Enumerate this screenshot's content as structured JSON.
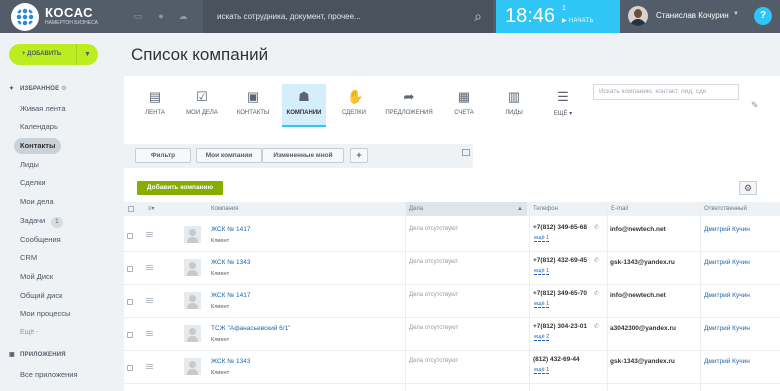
{
  "header": {
    "brand_name": "КОСАС",
    "brand_sub": "НАМЕРТОН БИЗНЕСА",
    "search_placeholder": "искать сотрудника, документ, прочее...",
    "clock": "18:46",
    "clock_flag": "1",
    "clock_action": "НАЧАТЬ",
    "user_name": "Станислав Кочурин",
    "help": "?"
  },
  "sidebar": {
    "add_button": "ДОБАВИТЬ",
    "favorites_title": "ИЗБРАННОЕ",
    "items": [
      {
        "label": "Живая лента",
        "active": false
      },
      {
        "label": "Календарь",
        "active": false
      },
      {
        "label": "Контакты",
        "active": true
      },
      {
        "label": "Лиды",
        "active": false
      },
      {
        "label": "Сделки",
        "active": false
      },
      {
        "label": "Мои дела",
        "active": false
      },
      {
        "label": "Задачи",
        "active": false,
        "count": "1"
      },
      {
        "label": "Сообщения",
        "active": false
      },
      {
        "label": "CRM",
        "active": false
      },
      {
        "label": "Мой Диск",
        "active": false
      },
      {
        "label": "Общий диск",
        "active": false
      },
      {
        "label": "Мои процессы",
        "active": false
      },
      {
        "label": "Ещё -",
        "active": false
      }
    ],
    "apps_title": "ПРИЛОЖЕНИЯ",
    "apps_items": [
      {
        "label": "Все приложения"
      }
    ]
  },
  "main": {
    "title": "Список компаний",
    "tabs": [
      {
        "label": "ЛЕНТА",
        "icon": "feed-icon",
        "glyph": "▤"
      },
      {
        "label": "МОИ ДЕЛА",
        "icon": "tasks-icon",
        "glyph": "☑"
      },
      {
        "label": "КОНТАКТЫ",
        "icon": "contacts-icon",
        "glyph": "▣"
      },
      {
        "label": "КОМПАНИИ",
        "icon": "companies-icon",
        "glyph": "☗",
        "active": true
      },
      {
        "label": "СДЕЛКИ",
        "icon": "deals-icon",
        "glyph": "✋"
      },
      {
        "label": "ПРЕДЛОЖЕНИЯ",
        "icon": "quotes-icon",
        "glyph": "➦"
      },
      {
        "label": "СЧЕТА",
        "icon": "invoices-icon",
        "glyph": "▦"
      },
      {
        "label": "ЛИДЫ",
        "icon": "leads-icon",
        "glyph": "▥"
      },
      {
        "label": "ЕЩЁ ▾",
        "icon": "more-icon",
        "glyph": "☰"
      }
    ],
    "tab_search_placeholder": "Искать компанию, контакт, лид, сде",
    "filter_buttons": [
      "Фильтр",
      "Мои компании",
      "Измененные мной",
      "+"
    ],
    "add_company": "Добавить компанию",
    "columns": [
      "Компания",
      "Дела",
      "Телефон",
      "E-mail",
      "Ответственный"
    ],
    "rows": [
      {
        "name": "ЖСК № 1417",
        "type": "Клиент",
        "deals": "Дела отсутствуют",
        "phone": "+7(812) 349-65-68",
        "phone2": "ещё 1",
        "email": "info@newtech.net",
        "resp": "Дмитрий Кучин"
      },
      {
        "name": "ЖСК № 1343",
        "type": "Клиент",
        "deals": "Дела отсутствуют",
        "phone": "+7(812) 432-69-45",
        "phone2": "ещё 1",
        "email": "gsk-1343@yandex.ru",
        "resp": "Дмитрий Кучин"
      },
      {
        "name": "ЖСК № 1417",
        "type": "Клиент",
        "deals": "Дела отсутствуют",
        "phone": "+7(812) 349-65-70",
        "phone2": "ещё 1",
        "email": "info@newtech.net",
        "resp": "Дмитрий Кучин"
      },
      {
        "name": "ТСЖ \"Афанасьевский 6/1\"",
        "type": "Клиент",
        "deals": "Дела отсутствуют",
        "phone": "+7(812) 304-23-01",
        "phone2": "ещё 2",
        "email": "a3042300@yandex.ru",
        "resp": "Дмитрий Кучин"
      },
      {
        "name": "ЖСК № 1343",
        "type": "Клиент",
        "deals": "Дела отсутствуют",
        "phone": "(812) 432-69-44",
        "phone2": "ещё 1",
        "email": "gsk-1343@yandex.ru",
        "resp": "Дмитрий Кучин"
      }
    ]
  },
  "colors": {
    "accent": "#2fc6f6",
    "topbar": "#535c69",
    "add_green": "#bbed21",
    "company_btn": "#86ad00",
    "link": "#2067b0"
  }
}
